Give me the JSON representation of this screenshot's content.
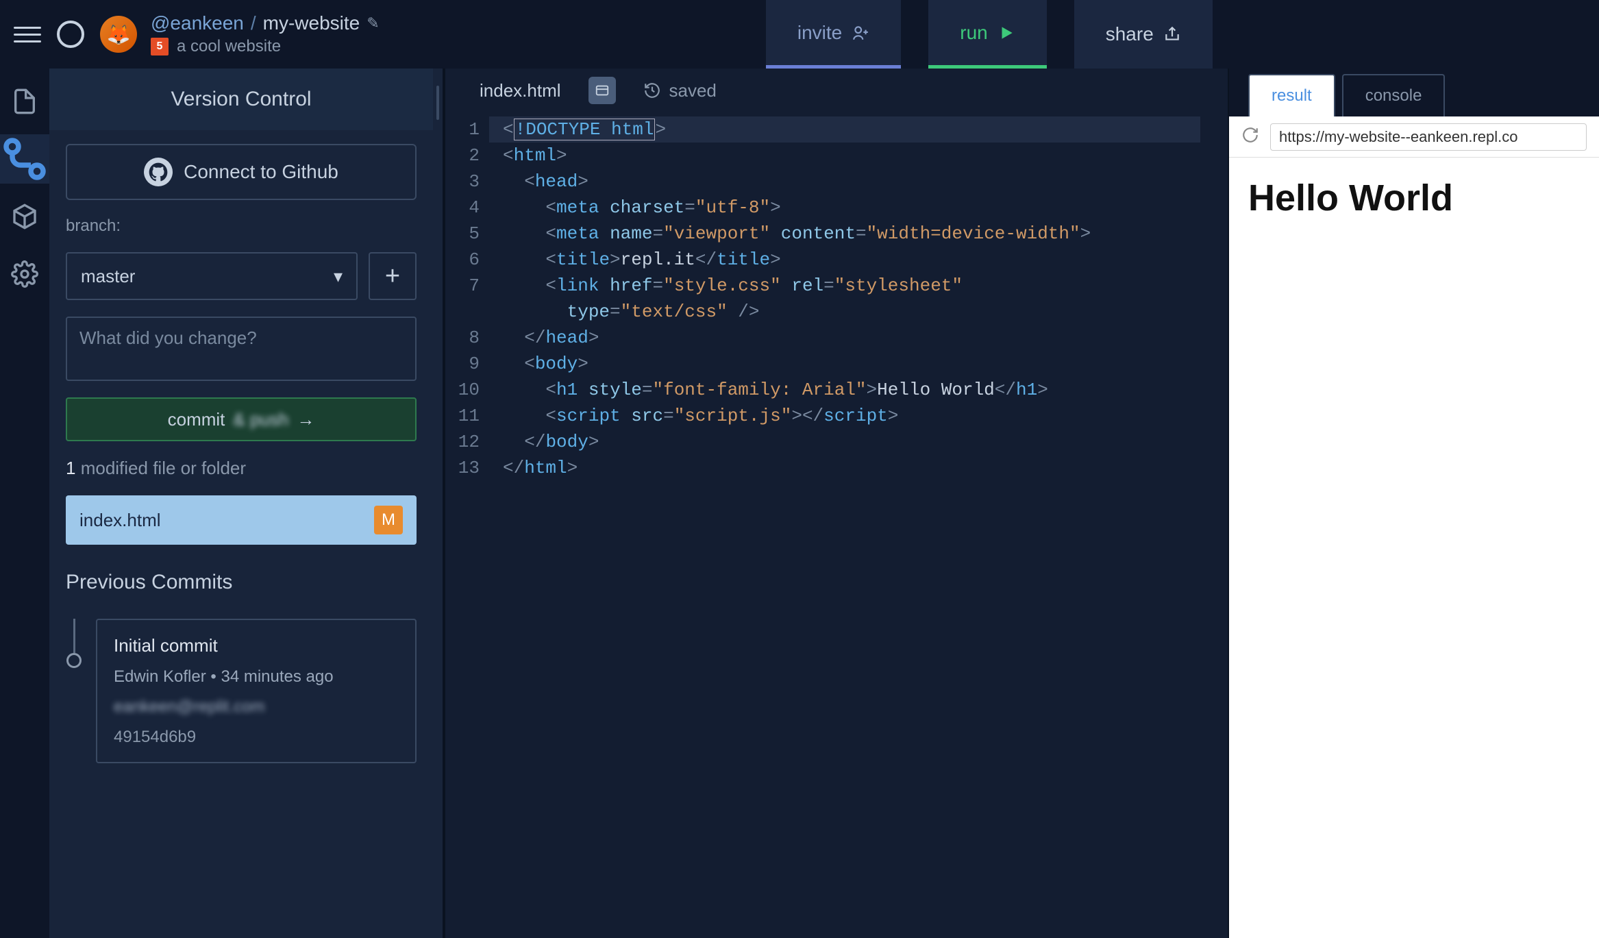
{
  "header": {
    "user": "@eankeen",
    "separator": "/",
    "repo": "my-website",
    "description": "a cool website",
    "html5_badge": "5"
  },
  "topActions": {
    "invite": "invite",
    "run": "run",
    "share": "share"
  },
  "sidebar": {
    "title": "Version Control",
    "github_button": "Connect to Github",
    "branch_label": "branch:",
    "branch_value": "master",
    "plus": "+",
    "commit_placeholder": "What did you change?",
    "commit_button_prefix": "commit",
    "commit_button_blur": "& push",
    "commit_arrow": "→",
    "modified_count": "1",
    "modified_text": "modified file or folder",
    "changed_file": "index.html",
    "changed_badge": "M",
    "previous_commits": "Previous Commits",
    "commits": [
      {
        "title": "Initial commit",
        "author": "Edwin Kofler",
        "time": "34 minutes ago",
        "email_blur": "eankeen@replit.com",
        "hash": "49154d6b9"
      }
    ]
  },
  "editor": {
    "filename": "index.html",
    "saved": "saved",
    "lines": {
      "l1_doctype": "!DOCTYPE html",
      "l2_html_open": "html",
      "l3_head_open": "head",
      "l4_meta": "meta",
      "l4_charset_attr": "charset",
      "l4_charset_val": "\"utf-8\"",
      "l5_meta": "meta",
      "l5_name_attr": "name",
      "l5_name_val": "\"viewport\"",
      "l5_content_attr": "content",
      "l5_content_val": "\"width=device-width\"",
      "l6_title": "title",
      "l6_title_text": "repl.it",
      "l7_link": "link",
      "l7_href_attr": "href",
      "l7_href_val": "\"style.css\"",
      "l7_rel_attr": "rel",
      "l7_rel_val": "\"stylesheet\"",
      "l7b_type_attr": "type",
      "l7b_type_val": "\"text/css\"",
      "l8_head_close": "head",
      "l9_body_open": "body",
      "l10_h1": "h1",
      "l10_style_attr": "style",
      "l10_style_val": "\"font-family: Arial\"",
      "l10_text": "Hello World",
      "l11_script": "script",
      "l11_src_attr": "src",
      "l11_src_val": "\"script.js\"",
      "l12_body_close": "body",
      "l13_html_close": "html"
    },
    "line_numbers": [
      "1",
      "2",
      "3",
      "4",
      "5",
      "6",
      "7",
      "",
      "8",
      "9",
      "10",
      "11",
      "12",
      "13"
    ]
  },
  "preview": {
    "tabs": {
      "result": "result",
      "console": "console"
    },
    "url": "https://my-website--eankeen.repl.co",
    "heading": "Hello World"
  }
}
